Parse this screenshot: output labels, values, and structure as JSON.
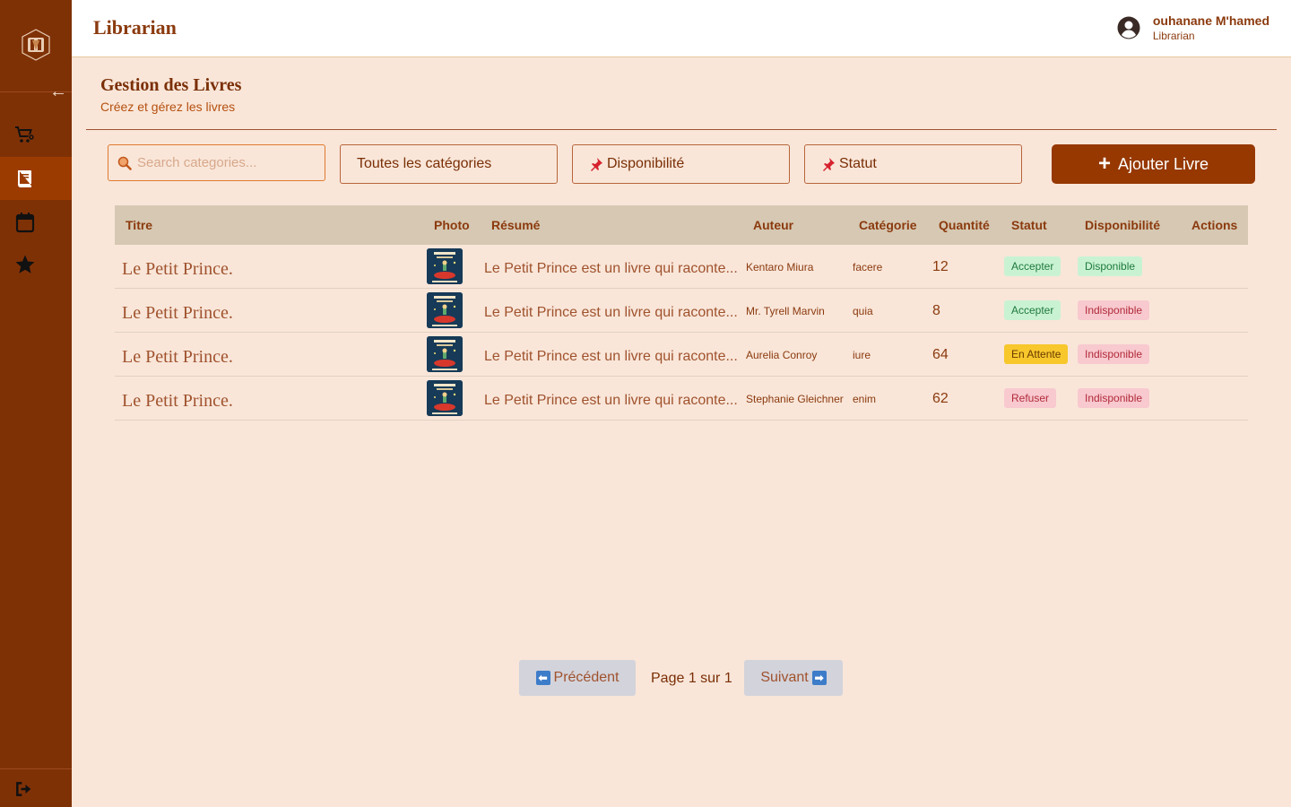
{
  "header": {
    "app_title": "Librarian",
    "user_name": "ouhanane M'hamed",
    "user_role": "Librarian"
  },
  "sidebar": {
    "collapse_glyph": "←",
    "items": [
      {
        "name": "cart-settings-icon",
        "active": false
      },
      {
        "name": "book-icon",
        "active": true
      },
      {
        "name": "calendar-icon",
        "active": false
      },
      {
        "name": "star-icon",
        "active": false
      }
    ],
    "logout_icon": "logout-icon"
  },
  "page": {
    "title": "Gestion des Livres",
    "subtitle": "Créez et gérez les livres"
  },
  "filters": {
    "search_placeholder": "Search categories...",
    "category_select": "Toutes les catégories",
    "availability_select": "Disponibilité",
    "status_select": "Statut",
    "add_button": "Ajouter Livre"
  },
  "table": {
    "headers": {
      "title": "Titre",
      "photo": "Photo",
      "resume": "Résumé",
      "author": "Auteur",
      "category": "Catégorie",
      "quantity": "Quantité",
      "status": "Statut",
      "availability": "Disponibilité",
      "actions": "Actions"
    },
    "rows": [
      {
        "title": "Le Petit Prince.",
        "resume": "Le Petit Prince est un livre qui raconte...",
        "author": "Kentaro Miura",
        "category": "facere",
        "quantity": "12",
        "status": "Accepter",
        "availability": "Disponible"
      },
      {
        "title": "Le Petit Prince.",
        "resume": "Le Petit Prince est un livre qui raconte...",
        "author": "Mr. Tyrell Marvin",
        "category": "quia",
        "quantity": "8",
        "status": "Accepter",
        "availability": "Indisponible"
      },
      {
        "title": "Le Petit Prince.",
        "resume": "Le Petit Prince est un livre qui raconte...",
        "author": "Aurelia Conroy",
        "category": "iure",
        "quantity": "64",
        "status": "En Attente",
        "availability": "Indisponible"
      },
      {
        "title": "Le Petit Prince.",
        "resume": "Le Petit Prince est un livre qui raconte...",
        "author": "Stephanie Gleichner",
        "category": "enim",
        "quantity": "62",
        "status": "Refuser",
        "availability": "Indisponible"
      }
    ]
  },
  "pagination": {
    "prev_label": "Précédent",
    "page_info": "Page 1 sur 1",
    "next_label": "Suivant"
  },
  "colors": {
    "sidebar": "#7f3106",
    "accent": "#963800",
    "background": "#f9e6d9",
    "table_header": "#d6c8b2"
  }
}
